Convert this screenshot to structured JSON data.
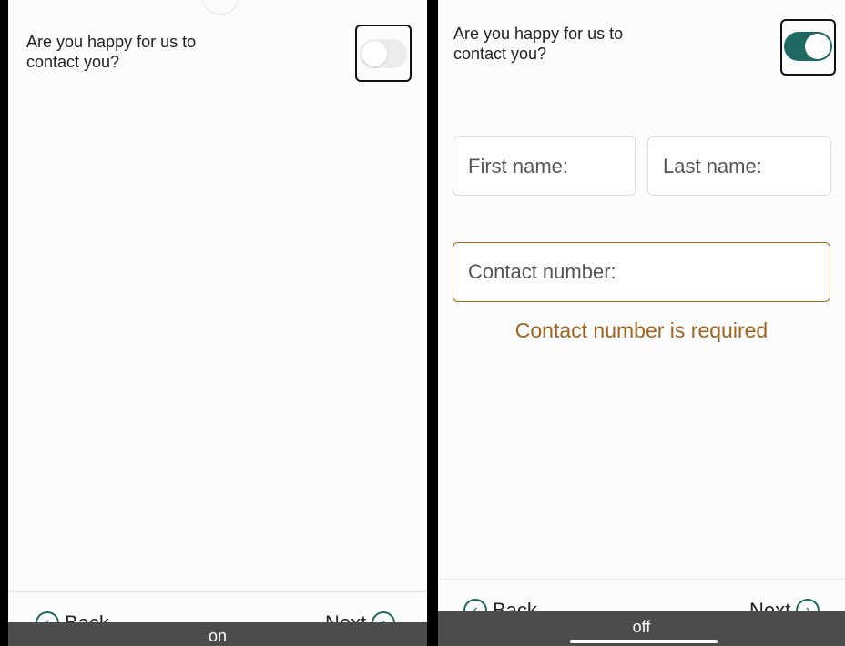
{
  "left_panel": {
    "question": "Are you happy for us to contact you?",
    "toggle_state": "off",
    "back_label": "Back",
    "next_label": "Next",
    "caption": "on"
  },
  "right_panel": {
    "question": "Are you happy for us to contact you?",
    "toggle_state": "on",
    "first_name_placeholder": "First name:",
    "last_name_placeholder": "Last name:",
    "contact_number_placeholder": "Contact number:",
    "error_message": "Contact number is required",
    "back_label": "Back",
    "next_label": "Next",
    "caption": "off"
  },
  "colors": {
    "accent": "#1e6a62",
    "error": "#a2631c"
  },
  "icons": {
    "back": "chevron-left-circle-icon",
    "next": "chevron-right-circle-icon"
  }
}
